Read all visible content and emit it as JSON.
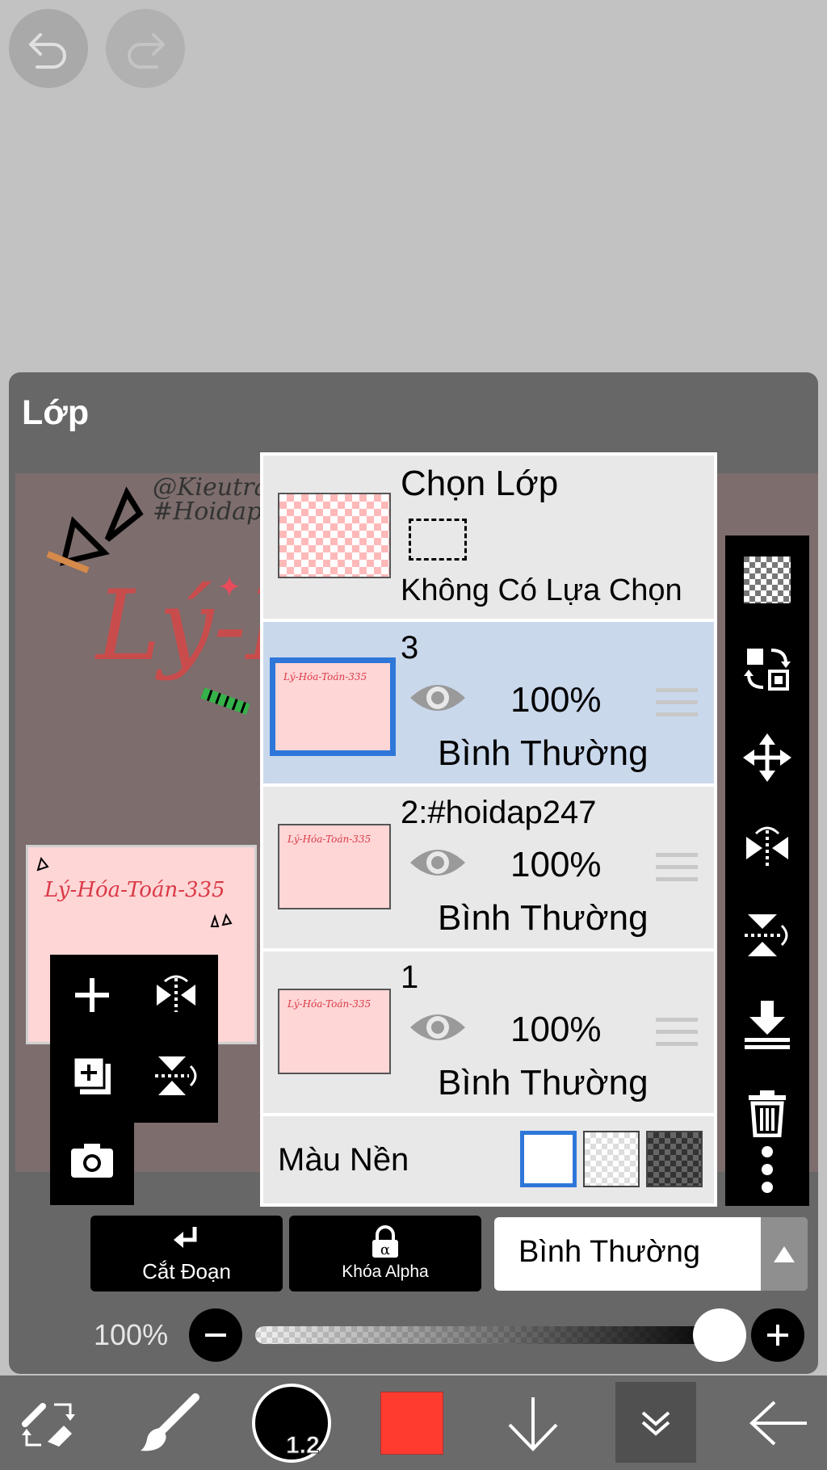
{
  "panel": {
    "title": "Lớp"
  },
  "artwork": {
    "handle_text": "@Kieutrang",
    "hashtag_text": "#Hoidap",
    "big_text": "Lý-H",
    "thumb_text": "Lý-Hóa-Toán-335"
  },
  "selection_row": {
    "title": "Chọn Lớp",
    "status": "Không Có Lựa Chọn"
  },
  "layers": [
    {
      "name": "3",
      "opacity": "100%",
      "mode": "Bình Thường",
      "selected": true
    },
    {
      "name": "2:#hoidap247",
      "opacity": "100%",
      "mode": "Bình Thường",
      "selected": false
    },
    {
      "name": "1",
      "opacity": "100%",
      "mode": "Bình Thường",
      "selected": false
    }
  ],
  "background_row": {
    "label": "Màu Nền"
  },
  "bar": {
    "clip_label": "Cắt Đoạn",
    "alpha_lock_label": "Khóa Alpha",
    "blend_mode": "Bình Thường"
  },
  "opacity": {
    "label": "100%",
    "value": 1.0
  },
  "brush": {
    "size": "1.2"
  },
  "colors": {
    "current_color": "#ff3b30",
    "selection_accent": "#2e77d9",
    "selected_row_bg": "#cad8ec"
  }
}
